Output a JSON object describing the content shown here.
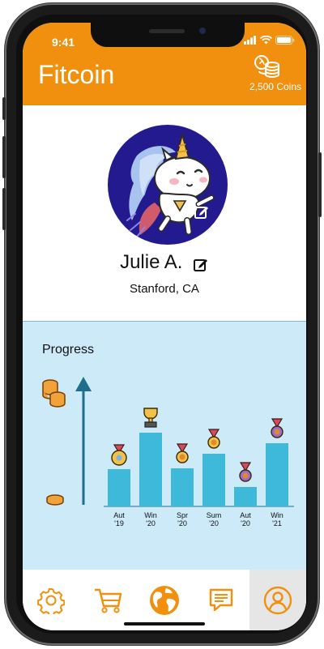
{
  "status_bar": {
    "time": "9:41"
  },
  "header": {
    "title": "Fitcoin",
    "coins_label": "2,500 Coins"
  },
  "profile": {
    "name": "Julie A.",
    "location": "Stanford, CA"
  },
  "progress": {
    "label": "Progress",
    "chart_data": {
      "type": "bar",
      "categories": [
        "Aut '19",
        "Win '20",
        "Spr '20",
        "Sum '20",
        "Aut '20",
        "Win '21"
      ],
      "tick_labels": [
        [
          "Aut",
          "'19"
        ],
        [
          "Win",
          "'20"
        ],
        [
          "Spr",
          "'20"
        ],
        [
          "Sum",
          "'20"
        ],
        [
          "Aut",
          "'20"
        ],
        [
          "Win",
          "'21"
        ]
      ],
      "values": [
        0.46,
        0.91,
        0.47,
        0.65,
        0.24,
        0.78
      ],
      "award_icons": [
        "ribbon-medal-icon",
        "trophy-icon",
        "medal-icon",
        "medal-icon",
        "rosette-medal-icon",
        "rosette-medal-icon"
      ],
      "bar_color": "#3fb9d9",
      "axis_color": "#1f6f8b"
    }
  },
  "colors": {
    "accent": "#f0900e",
    "panel": "#cdeaf8",
    "avatar_bg": "#241a8f"
  },
  "nav": {
    "items": [
      "settings-icon",
      "cart-icon",
      "globe-icon",
      "chat-icon",
      "profile-icon"
    ],
    "active": "profile-icon"
  }
}
